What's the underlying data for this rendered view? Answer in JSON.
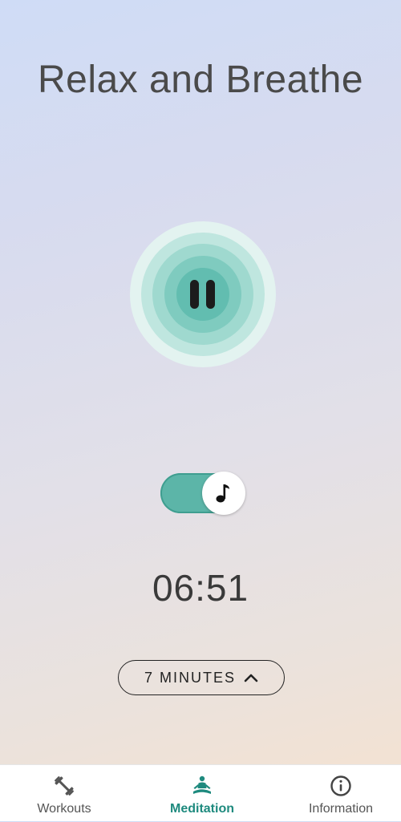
{
  "header": {
    "title": "Relax and Breathe"
  },
  "player": {
    "state_icon": "pause-icon",
    "music_toggle_on": true,
    "music_icon": "music-note-icon"
  },
  "timer": {
    "remaining": "06:51"
  },
  "duration": {
    "label": "7 MINUTES",
    "icon": "chevron-up-icon"
  },
  "nav": {
    "items": [
      {
        "label": "Workouts",
        "icon": "dumbbell-icon",
        "active": false
      },
      {
        "label": "Meditation",
        "icon": "meditation-icon",
        "active": true
      },
      {
        "label": "Information",
        "icon": "info-icon",
        "active": false
      }
    ]
  },
  "colors": {
    "accent": "#1e8a7e",
    "toggle_track": "#5cb5a8",
    "ring_core": "#62bdb0"
  }
}
